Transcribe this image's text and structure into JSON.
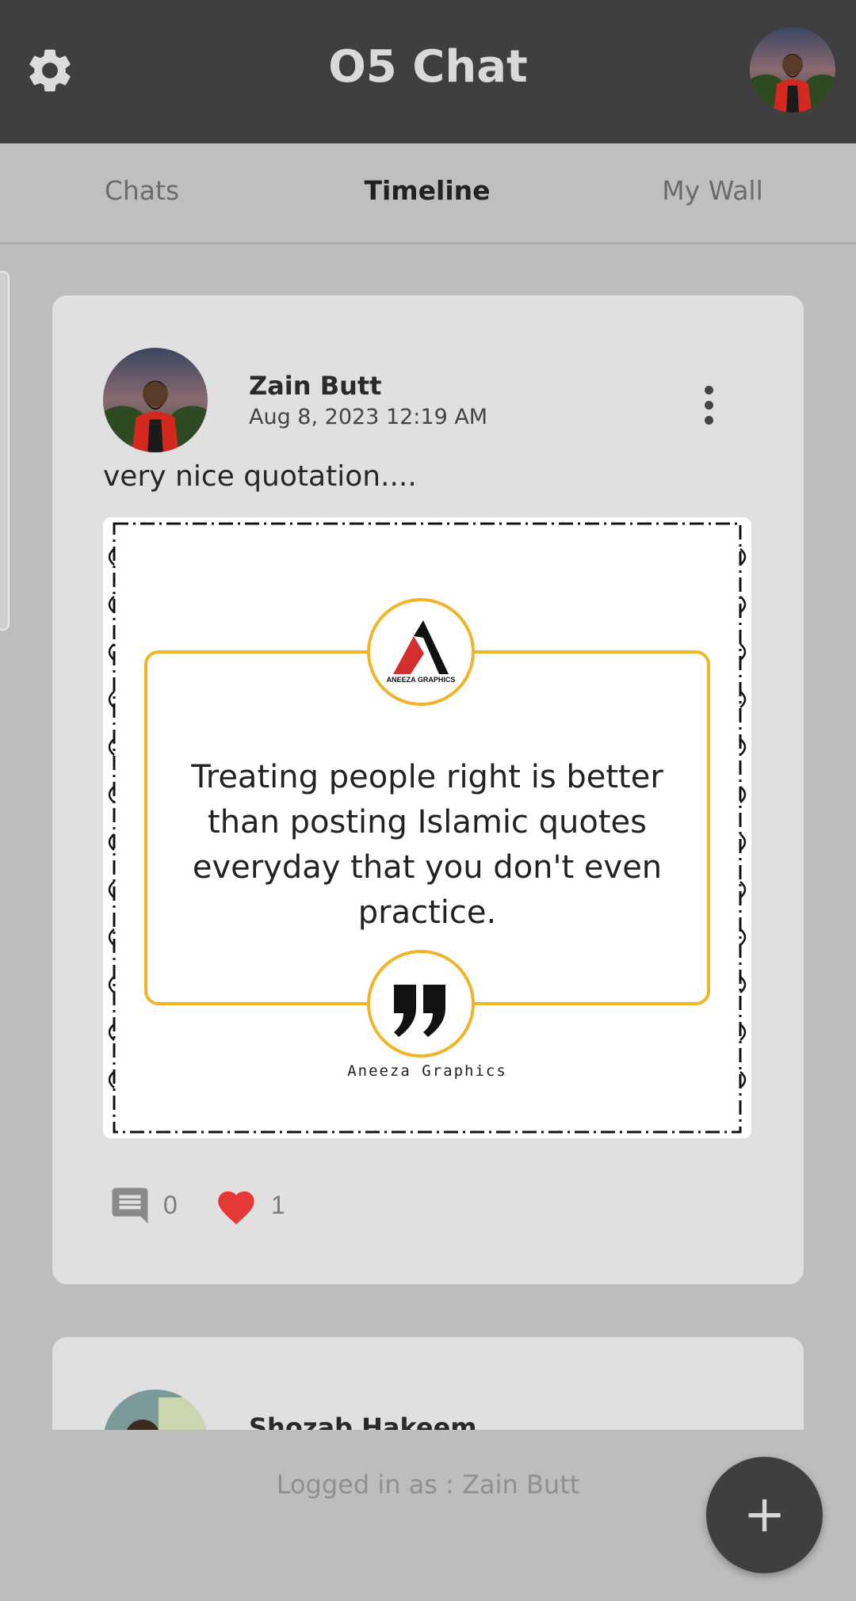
{
  "header": {
    "title": "O5 Chat",
    "settings_icon": "gear-icon",
    "profile_avatar": "user-avatar"
  },
  "tabs": [
    {
      "label": "Chats",
      "active": false
    },
    {
      "label": "Timeline",
      "active": true
    },
    {
      "label": "My Wall",
      "active": false
    }
  ],
  "posts": [
    {
      "author": "Zain Butt",
      "date": "Aug 8, 2023 12:19 AM",
      "text": "very nice quotation....",
      "image": {
        "quote": "Treating people right is better than posting Islamic quotes everyday that you don't even practice.",
        "logo_text": "ANEEZA GRAPHICS",
        "brand": "Aneeza Graphics"
      },
      "comments": "0",
      "likes": "1"
    },
    {
      "author": "Shozab Hakeem"
    }
  ],
  "footer": {
    "logged_in": "Logged in as : Zain Butt",
    "fab_label": "+"
  },
  "colors": {
    "appbar": "#3f3f3f",
    "background": "#bdbdbd",
    "card": "#e0e0e0",
    "heart": "#e53935",
    "quote_frame": "#f0b429"
  }
}
